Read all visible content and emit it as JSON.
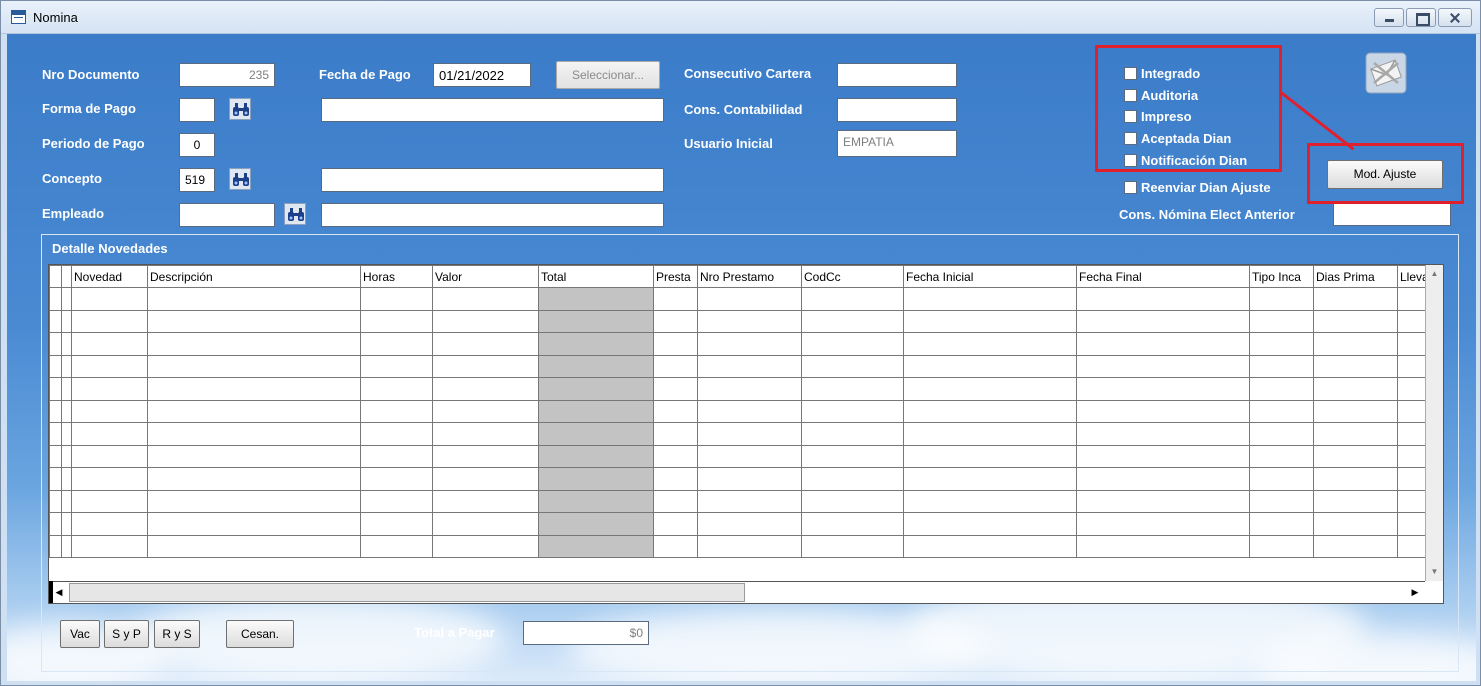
{
  "window": {
    "title": "Nomina"
  },
  "fields": {
    "nro_documento": {
      "label": "Nro Documento",
      "value": "235"
    },
    "fecha_pago": {
      "label": "Fecha de Pago",
      "value": "01/21/2022"
    },
    "seleccionar": "Seleccionar...",
    "forma_pago": {
      "label": "Forma de Pago",
      "value": "",
      "description": ""
    },
    "periodo_pago": {
      "label": "Periodo de Pago",
      "value": "0"
    },
    "concepto": {
      "label": "Concepto",
      "value": "519",
      "description": ""
    },
    "empleado": {
      "label": "Empleado",
      "value": "",
      "description": ""
    },
    "consecutivo_cartera": {
      "label": "Consecutivo Cartera",
      "value": ""
    },
    "cons_contabilidad": {
      "label": "Cons. Contabilidad",
      "value": ""
    },
    "usuario_inicial": {
      "label": "Usuario Inicial",
      "value": "EMPATIA"
    },
    "cons_nomina_anterior": {
      "label": "Cons. Nómina Elect Anterior",
      "value": ""
    }
  },
  "checkboxes": {
    "integrado": "Integrado",
    "auditoria": "Auditoria",
    "impreso": "Impreso",
    "aceptada_dian": "Aceptada Dian",
    "notificacion_dian": "Notificación Dian",
    "reenviar_dian_ajuste": "Reenviar Dian Ajuste"
  },
  "mod_ajuste": "Mod. Ajuste",
  "detalle": {
    "title": "Detalle Novedades",
    "columns": [
      "Novedad",
      "Descripción",
      "Horas",
      "Valor",
      "Total",
      "Presta",
      "Nro Prestamo",
      "CodCc",
      "Fecha Inicial",
      "Fecha Final",
      "Tipo Inca",
      "Dias Prima",
      "Lleva"
    ]
  },
  "buttons": {
    "vac": "Vac",
    "syp": "S y P",
    "rys": "R y S",
    "cesan": "Cesan."
  },
  "total_pagar": {
    "label": "Total a Pagar",
    "value": "$0"
  },
  "icons": {
    "app": "app-form-icon",
    "finder": "binoculars-icon",
    "envelope": "email-envelope-icon"
  },
  "colors": {
    "highlight": "#e0202c",
    "background": "#3b7cc9"
  }
}
